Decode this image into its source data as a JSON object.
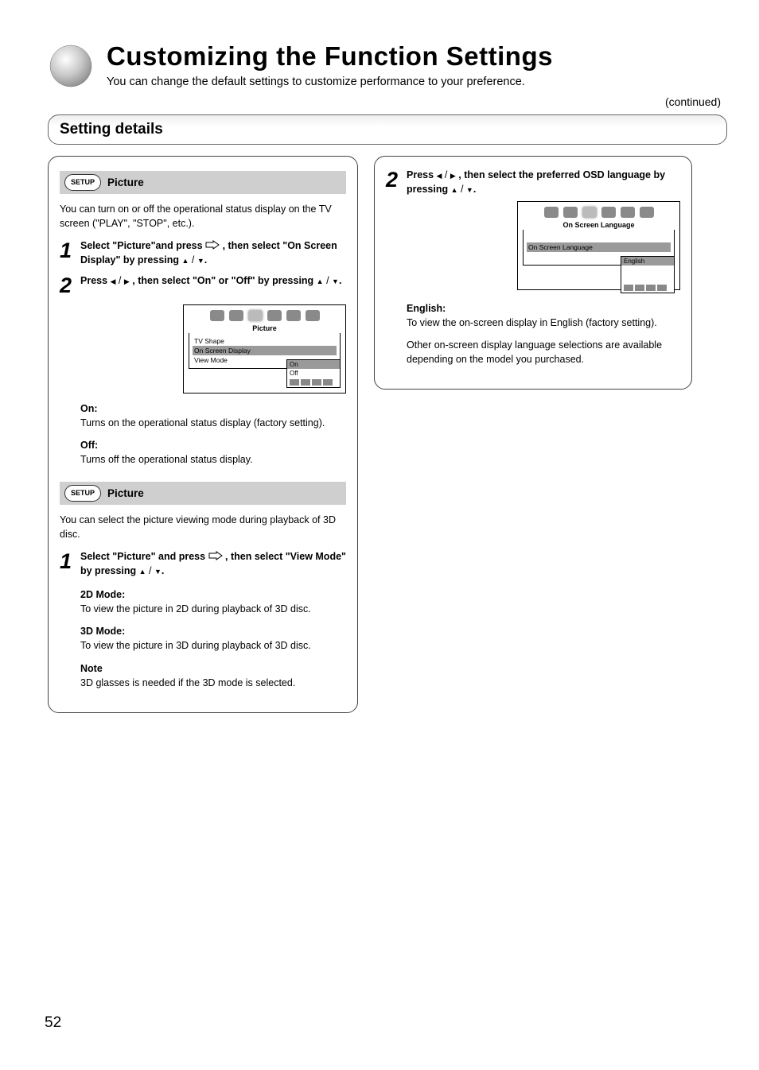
{
  "page_number": "52",
  "header": {
    "title": "Customizing the Function Settings",
    "subtitle_l1": "You can change the default settings to customize performance to your preference.",
    "continued": "(continued)"
  },
  "banner": "Setting details",
  "left": {
    "step1": {
      "oval": "SETUP",
      "title": "Picture",
      "intro": "You can turn on or off the operational status display on the TV screen (\"PLAY\", \"STOP\", etc.).",
      "s1_a": "Select \"Picture\"and press",
      "s1_b": ", then select \"On Screen Display\" by pressing ",
      "s1_c": "Press ",
      "s1_d": ", then select \"On\" or \"Off\" by pressing  ",
      "dialog": {
        "heading": "Picture",
        "items": [
          "TV Shape",
          "On Screen Display",
          "View Mode"
        ],
        "sub": [
          "On",
          "Off"
        ]
      },
      "opt_on_label": "On:",
      "opt_on_desc": "Turns on the operational status display (factory setting).",
      "opt_off_label": "Off:",
      "opt_off_desc": "Turns off the operational status display."
    },
    "step2": {
      "oval": "SETUP",
      "title": "Picture",
      "intro": "You can select the picture viewing mode during playback of 3D disc.",
      "s1_a": "Select \"Picture\" and press ",
      "s1_b": ", then select \"View Mode\" by pressing ",
      "opt_2d_label": "2D Mode:",
      "opt_2d_desc": "To view the picture in 2D during playback of 3D disc.",
      "opt_3d_label": "3D Mode:",
      "opt_3d_desc": "To view the picture in 3D during playback of 3D disc.",
      "note_label": "Note",
      "note_body": "3D glasses is needed if the 3D mode is selected."
    }
  },
  "right": {
    "s2_a": "Press ",
    "s2_b": ", then select the preferred OSD language by pressing ",
    "dialog": {
      "heading": "On Screen Language",
      "items": [
        "On Screen Language"
      ],
      "sub": [
        "English"
      ]
    },
    "opt_en_label": "English:",
    "opt_en_desc": "To view the on-screen display in English (factory setting).",
    "trailing": "Other on-screen display language selections are available depending on the model you purchased."
  }
}
